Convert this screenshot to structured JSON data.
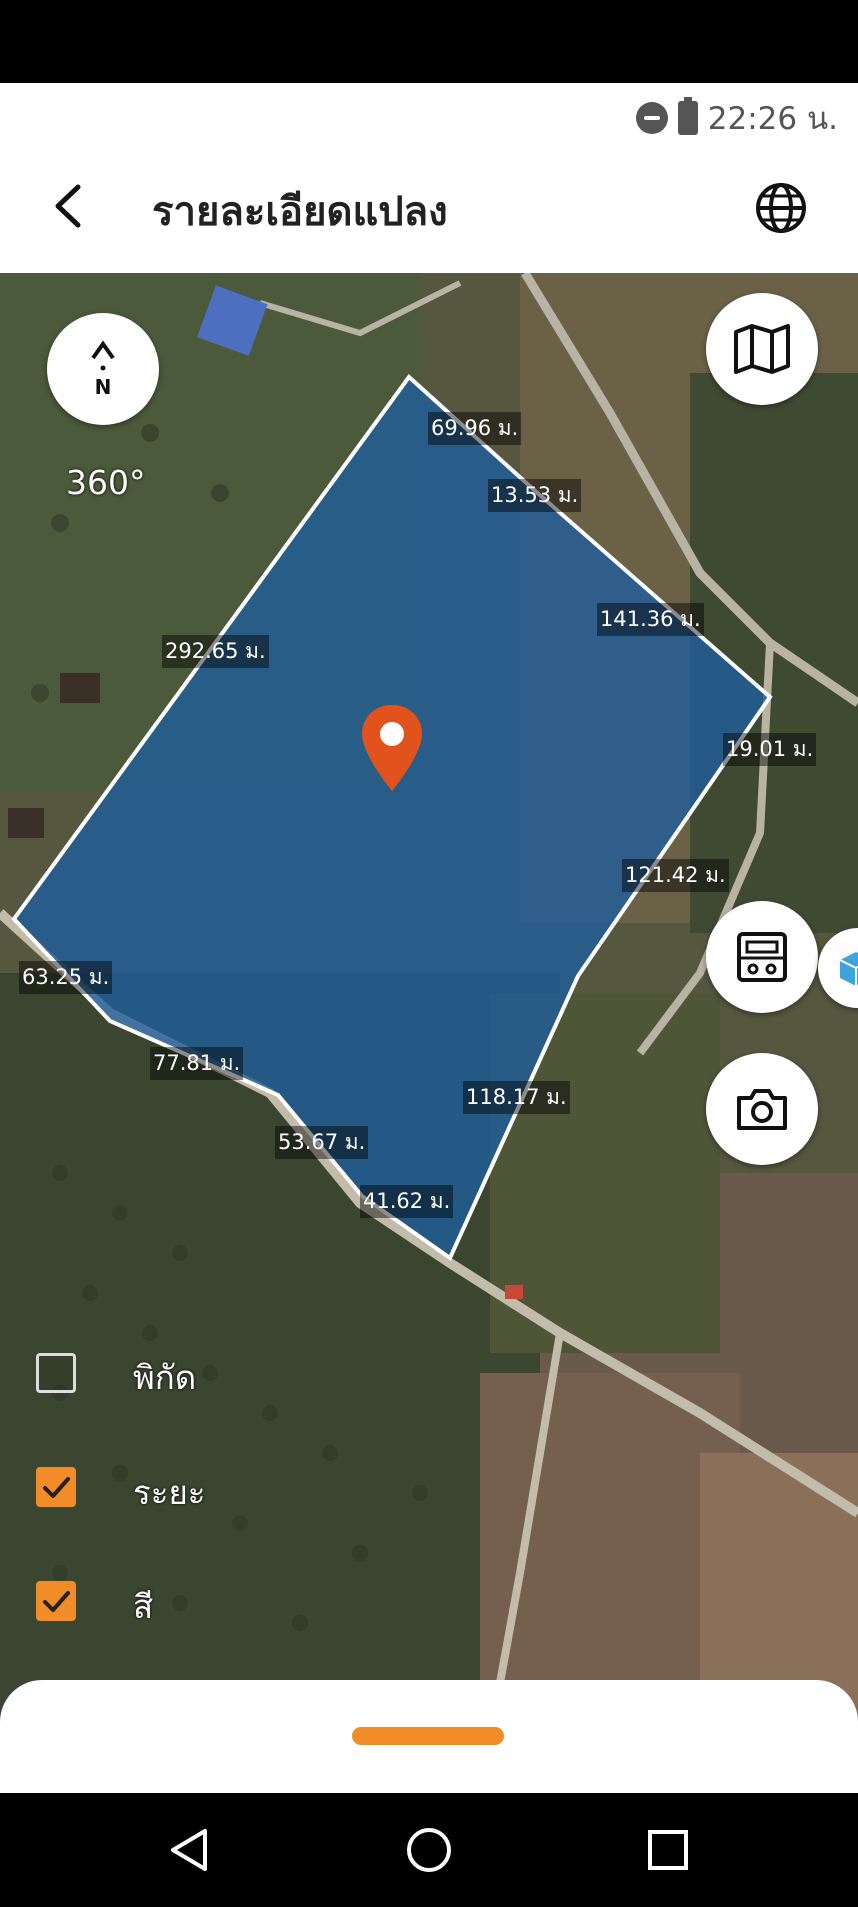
{
  "status": {
    "time": "22:26 น."
  },
  "header": {
    "title": "รายละเอียดแปลง"
  },
  "map": {
    "compass_letter": "N",
    "rotation": "360°",
    "measurements": [
      {
        "id": "m1",
        "text": "69.96 ม."
      },
      {
        "id": "m2",
        "text": "13.53 ม."
      },
      {
        "id": "m3",
        "text": "141.36 ม."
      },
      {
        "id": "m4",
        "text": "292.65 ม."
      },
      {
        "id": "m5",
        "text": "19.01 ม."
      },
      {
        "id": "m6",
        "text": "121.42 ม."
      },
      {
        "id": "m7",
        "text": "63.25 ม."
      },
      {
        "id": "m8",
        "text": "77.81 ม."
      },
      {
        "id": "m9",
        "text": "118.17 ม."
      },
      {
        "id": "m10",
        "text": "53.67 ม."
      },
      {
        "id": "m11",
        "text": "41.62 ม."
      }
    ]
  },
  "layers": {
    "coordinates": {
      "label": "พิกัด",
      "checked": false
    },
    "distance": {
      "label": "ระยะ",
      "checked": true
    },
    "color": {
      "label": "สี",
      "checked": true
    }
  },
  "colors": {
    "accent": "#f28c28",
    "polygon_fill": "#1f5e9e",
    "pin": "#e2521d"
  }
}
